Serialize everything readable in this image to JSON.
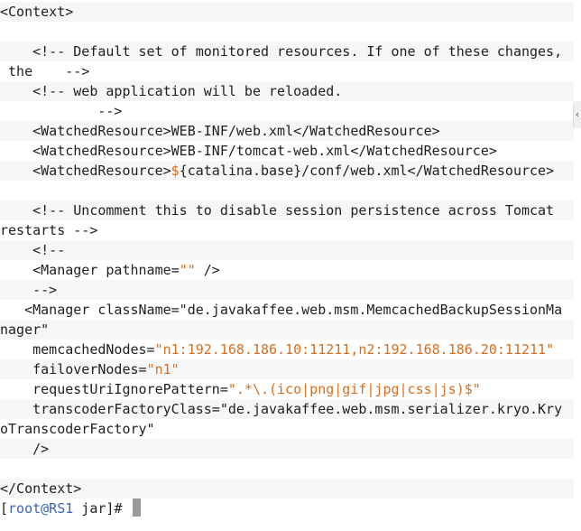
{
  "terminal": {
    "lines": [
      {
        "segments": [
          {
            "text": "<Context>",
            "c": "t"
          }
        ]
      },
      {
        "segments": []
      },
      {
        "segments": [
          {
            "text": "    <!-- Default set of monitored resources. If one of these changes,",
            "c": "t"
          }
        ]
      },
      {
        "segments": [
          {
            "text": " the    -->",
            "c": "t"
          }
        ]
      },
      {
        "segments": [
          {
            "text": "    <!-- web application will be reloaded.",
            "c": "t"
          }
        ]
      },
      {
        "segments": [
          {
            "text": "            -->",
            "c": "t"
          }
        ]
      },
      {
        "segments": [
          {
            "text": "    <WatchedResource>WEB-INF/web.xml</WatchedResource>",
            "c": "t"
          }
        ]
      },
      {
        "segments": [
          {
            "text": "    <WatchedResource>WEB-INF/tomcat-web.xml</WatchedResource>",
            "c": "t"
          }
        ]
      },
      {
        "segments": [
          {
            "text": "    <WatchedResource>",
            "c": "t"
          },
          {
            "text": "$",
            "c": "o"
          },
          {
            "text": "{catalina.base}/conf/web.xml</WatchedResource>",
            "c": "t"
          }
        ]
      },
      {
        "segments": []
      },
      {
        "segments": [
          {
            "text": "    <!-- Uncomment this to disable session persistence across Tomcat",
            "c": "t"
          }
        ]
      },
      {
        "segments": [
          {
            "text": "restarts -->",
            "c": "t"
          }
        ]
      },
      {
        "segments": [
          {
            "text": "    <!--",
            "c": "t"
          }
        ]
      },
      {
        "segments": [
          {
            "text": "    <Manager pathname=",
            "c": "t"
          },
          {
            "text": "\"\"",
            "c": "o"
          },
          {
            "text": " />",
            "c": "t"
          }
        ]
      },
      {
        "segments": [
          {
            "text": "    -->",
            "c": "t"
          }
        ]
      },
      {
        "segments": [
          {
            "text": "   <Manager className=\"de.javakaffee.web.msm.MemcachedBackupSessionMa",
            "c": "t"
          }
        ]
      },
      {
        "segments": [
          {
            "text": "nager\"",
            "c": "t"
          }
        ]
      },
      {
        "segments": [
          {
            "text": "    memcachedNodes=",
            "c": "t"
          },
          {
            "text": "\"n1:192.168.186.10:11211,n2:192.168.186.20:11211\"",
            "c": "o"
          }
        ]
      },
      {
        "segments": [
          {
            "text": "    failoverNodes=",
            "c": "t"
          },
          {
            "text": "\"n1\"",
            "c": "o"
          }
        ]
      },
      {
        "segments": [
          {
            "text": "    requestUriIgnorePattern=",
            "c": "t"
          },
          {
            "text": "\".*\\.(ico|png|gif|jpg|css|js)$\"",
            "c": "o"
          }
        ]
      },
      {
        "segments": [
          {
            "text": "    transcoderFactoryClass=\"de.javakaffee.web.msm.serializer.kryo.Kry",
            "c": "t"
          }
        ]
      },
      {
        "segments": [
          {
            "text": "oTranscoderFactory\"",
            "c": "t"
          }
        ]
      },
      {
        "segments": [
          {
            "text": "    />",
            "c": "t"
          }
        ]
      },
      {
        "segments": []
      },
      {
        "segments": [
          {
            "text": "</Context>",
            "c": "t"
          }
        ]
      }
    ],
    "prompt": {
      "open": "[",
      "user_host": "root@RS1",
      "cwd": " jar",
      "close": "]",
      "symbol": "# "
    }
  },
  "scroll_handle_glyph": "‹",
  "colors": {
    "text": "#1f1f1f",
    "string": "#d96e1d",
    "prompt_user": "#3a63b8",
    "alt_row": "#f5f6f8",
    "cursor": "#9a9a9a"
  }
}
